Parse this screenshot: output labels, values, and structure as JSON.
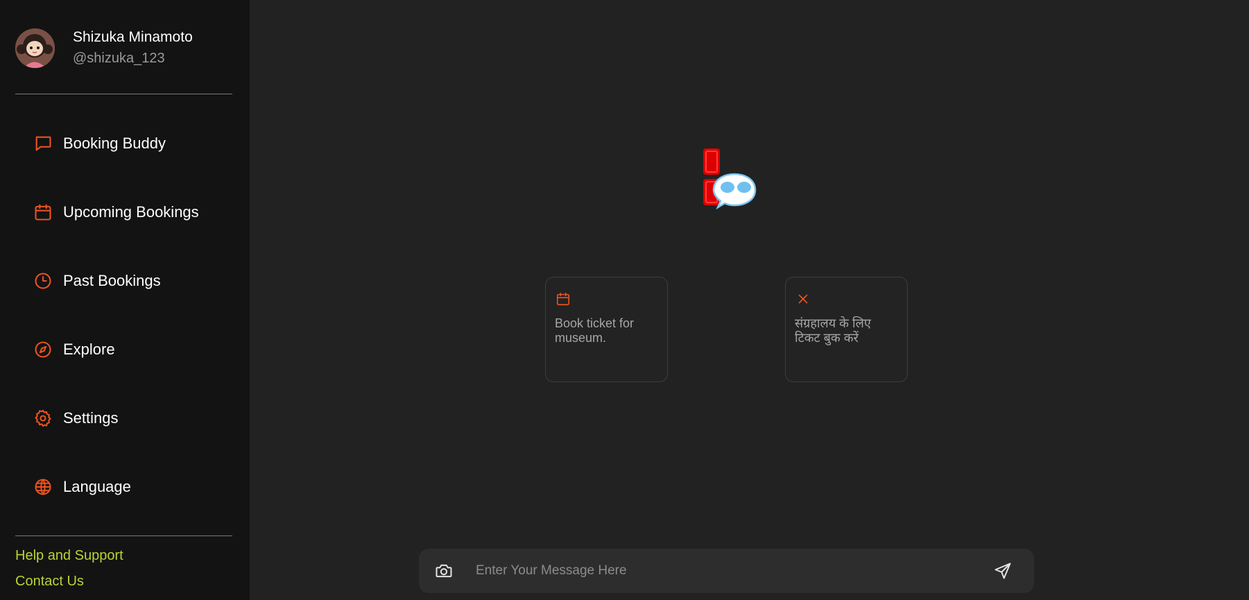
{
  "user": {
    "name": "Shizuka Minamoto",
    "handle": "@shizuka_123"
  },
  "nav": [
    {
      "label": "Booking Buddy",
      "icon": "chat-bubble-icon"
    },
    {
      "label": "Upcoming Bookings",
      "icon": "calendar-icon"
    },
    {
      "label": "Past Bookings",
      "icon": "clock-icon"
    },
    {
      "label": "Explore",
      "icon": "compass-icon"
    },
    {
      "label": "Settings",
      "icon": "gear-icon"
    },
    {
      "label": "Language",
      "icon": "globe-icon"
    }
  ],
  "footer": {
    "help": "Help and Support",
    "contact": "Contact Us"
  },
  "suggestions": [
    {
      "icon": "calendar-icon",
      "text": "Book ticket for museum."
    },
    {
      "icon": "close-icon",
      "text": "संग्रहालय के लिए टिकट बुक करें"
    }
  ],
  "composer": {
    "placeholder": "Enter Your Message Here",
    "value": ""
  },
  "colors": {
    "accent": "#e9531f",
    "link": "#b9d436",
    "sidebar_bg": "#131313",
    "main_bg": "#222222"
  }
}
